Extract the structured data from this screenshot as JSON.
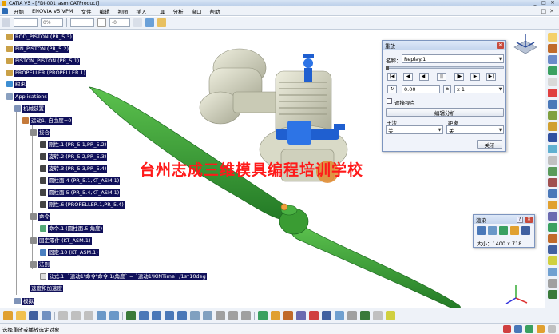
{
  "window": {
    "title": "CATIA V5 - [FDI-001_asm.CATProduct]",
    "controls": [
      "_",
      "□",
      "✕"
    ]
  },
  "menu": {
    "items": [
      "开始",
      "ENOVIA V5 VPM",
      "文件",
      "编辑",
      "视图",
      "插入",
      "工具",
      "分析",
      "窗口",
      "帮助"
    ],
    "right_controls": [
      "_",
      "□",
      "✕"
    ]
  },
  "toolbar": {
    "combo1": "",
    "combo2": "0%",
    "combo3": "",
    "combo4": "-0"
  },
  "tree": {
    "items": [
      {
        "label": "ROD_PISTON (PR_5.3)"
      },
      {
        "label": "PIN_PISTON (PR_5.2)"
      },
      {
        "label": "PISTON_PISTON (PR_5.1)"
      },
      {
        "label": "PROPELLER (PROPELLER.1)"
      },
      {
        "label": "约束"
      },
      {
        "label": "Applications"
      },
      {
        "label": "机械装置"
      },
      {
        "label": "运动1, 自由度=0"
      },
      {
        "label": "接合"
      },
      {
        "label": "刚性.1 (PR_5.1,PR_5.2)"
      },
      {
        "label": "旋转.2 (PR_5.2,PR_5.3)"
      },
      {
        "label": "旋转.3 (PR_5.3,PR_5.4)"
      },
      {
        "label": "圆柱面.4 (PR_5.1,KT_ASM.1)"
      },
      {
        "label": "圆柱面.5 (PR_5.4,KT_ASM.1)"
      },
      {
        "label": "刚性.6 (PROPELLER.1,PR_5.4)"
      },
      {
        "label": "命令"
      },
      {
        "label": "命令.1 (圆柱面.5,角度)"
      },
      {
        "label": "固定零件 (KT_ASM.1)"
      },
      {
        "label": "固定.10 (KT_ASM.1)"
      },
      {
        "label": "法则"
      },
      {
        "label": "公式.1: `运动1\\命令\\命令.1\\角度` = `运动1\\KINTime` /1s*10deg"
      },
      {
        "label": "速度和加速度"
      },
      {
        "label": "模拟"
      }
    ]
  },
  "watermark": "台州志成三维模具编程培训学校",
  "replay_dialog": {
    "title": "重放",
    "name_label": "名称：",
    "name_value": "Replay.1",
    "step_value": "0.00",
    "speed_value": "x 1",
    "checkbox_label": "遮掩视点",
    "edit_button": "编辑分析",
    "col1_label": "干涉",
    "col2_label": "距离",
    "col1_value": "关",
    "col2_value": "关",
    "close_button": "关闭",
    "transport": [
      "|◀",
      "◀",
      "◀|",
      "||",
      "|▶",
      "▶",
      "▶|"
    ]
  },
  "render_dialog": {
    "title": "渲染",
    "size_text": "大小：1400 x 718"
  },
  "status": {
    "text": "选择重放或播放选定对象"
  },
  "colors": {
    "tree_highlight": "#10105a",
    "propeller": "#3ca33c",
    "engine": "#d4d5c2",
    "engine_blue": "#1f5fd0",
    "watermark": "#ff1a1a"
  }
}
